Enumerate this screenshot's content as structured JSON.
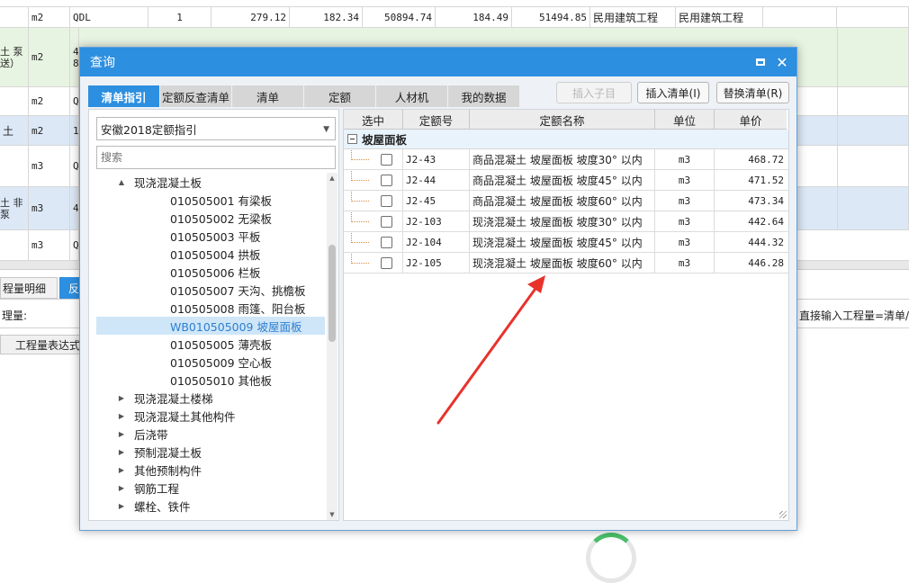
{
  "background": {
    "row_top": {
      "unit": "m2",
      "code": "QDL",
      "qty": "1",
      "v1": "279.12",
      "v2": "182.34",
      "v3": "50894.74",
      "v4": "184.49",
      "v5": "51494.85",
      "cat1": "民用建筑工程",
      "cat2": "民用建筑工程"
    },
    "row_a": {
      "name": "土\n泵送）",
      "unit": "m2",
      "code": "4\n8"
    },
    "row_b": {
      "unit": "m2",
      "code": "Q"
    },
    "row_c": {
      "name": "土",
      "unit": "m2",
      "code": "1"
    },
    "row_d": {
      "unit": "m3",
      "code": "Q"
    },
    "row_e": {
      "name": "土\n非泵",
      "unit": "m3",
      "code": "4"
    },
    "row_f": {
      "unit": "m3",
      "code": "Q"
    },
    "lower_tab_label": "程量明细",
    "lower_tab2_label": "反",
    "qty_label": "理量:",
    "qty_hint": "直接输入工程量=清单/",
    "expr_button": "工程量表达式"
  },
  "dialog": {
    "title": "查询",
    "tabs": [
      {
        "label": "清单指引",
        "active": true
      },
      {
        "label": "定额反查清单",
        "active": false
      },
      {
        "label": "清单",
        "active": false
      },
      {
        "label": "定额",
        "active": false
      },
      {
        "label": "人材机",
        "active": false
      },
      {
        "label": "我的数据",
        "active": false
      }
    ],
    "buttons": {
      "insert_child": "插入子目",
      "insert_list": "插入清单(I)",
      "replace_list": "替换清单(R)"
    },
    "guide_select": "安徽2018定额指引",
    "search_placeholder": "搜索",
    "tree": [
      {
        "label": "现浇混凝土板",
        "level": 1,
        "toggle": "▲",
        "selected": false
      },
      {
        "label": "010505001  有梁板",
        "level": 2,
        "toggle": "",
        "selected": false
      },
      {
        "label": "010505002  无梁板",
        "level": 2,
        "toggle": "",
        "selected": false
      },
      {
        "label": "010505003  平板",
        "level": 2,
        "toggle": "",
        "selected": false
      },
      {
        "label": "010505004  拱板",
        "level": 2,
        "toggle": "",
        "selected": false
      },
      {
        "label": "010505006  栏板",
        "level": 2,
        "toggle": "",
        "selected": false
      },
      {
        "label": "010505007  天沟、挑檐板",
        "level": 2,
        "toggle": "",
        "selected": false
      },
      {
        "label": "010505008  雨篷、阳台板",
        "level": 2,
        "toggle": "",
        "selected": false
      },
      {
        "label": "WB010505009  坡屋面板",
        "level": 2,
        "toggle": "",
        "selected": true
      },
      {
        "label": "010505005  薄壳板",
        "level": 2,
        "toggle": "",
        "selected": false
      },
      {
        "label": "010505009  空心板",
        "level": 2,
        "toggle": "",
        "selected": false
      },
      {
        "label": "010505010  其他板",
        "level": 2,
        "toggle": "",
        "selected": false
      },
      {
        "label": "现浇混凝土楼梯",
        "level": 1,
        "toggle": "▶",
        "selected": false
      },
      {
        "label": "现浇混凝土其他构件",
        "level": 1,
        "toggle": "▶",
        "selected": false
      },
      {
        "label": "后浇带",
        "level": 1,
        "toggle": "▶",
        "selected": false
      },
      {
        "label": "预制混凝土板",
        "level": 1,
        "toggle": "▶",
        "selected": false
      },
      {
        "label": "其他预制构件",
        "level": 1,
        "toggle": "▶",
        "selected": false
      },
      {
        "label": "钢筋工程",
        "level": 1,
        "toggle": "▶",
        "selected": false
      },
      {
        "label": "螺栓、铁件",
        "level": 1,
        "toggle": "▶",
        "selected": false
      }
    ],
    "grid": {
      "headers": [
        "选中",
        "定额号",
        "定额名称",
        "单位",
        "单价"
      ],
      "group_label": "坡屋面板",
      "rows": [
        {
          "code": "J2-43",
          "name": "商品混凝土 坡屋面板 坡度30° 以内",
          "unit": "m3",
          "price": "468.72"
        },
        {
          "code": "J2-44",
          "name": "商品混凝土 坡屋面板 坡度45° 以内",
          "unit": "m3",
          "price": "471.52"
        },
        {
          "code": "J2-45",
          "name": "商品混凝土 坡屋面板 坡度60° 以内",
          "unit": "m3",
          "price": "473.34"
        },
        {
          "code": "J2-103",
          "name": "现浇混凝土 坡屋面板 坡度30° 以内",
          "unit": "m3",
          "price": "442.64"
        },
        {
          "code": "J2-104",
          "name": "现浇混凝土 坡屋面板 坡度45° 以内",
          "unit": "m3",
          "price": "444.32"
        },
        {
          "code": "J2-105",
          "name": "现浇混凝土 坡屋面板 坡度60° 以内",
          "unit": "m3",
          "price": "446.28"
        }
      ]
    }
  },
  "colors": {
    "accent": "#2d8fe0",
    "row_green": "#e8f4e2",
    "row_blue": "#dce8f6",
    "annotation_arrow": "#e8322c"
  }
}
